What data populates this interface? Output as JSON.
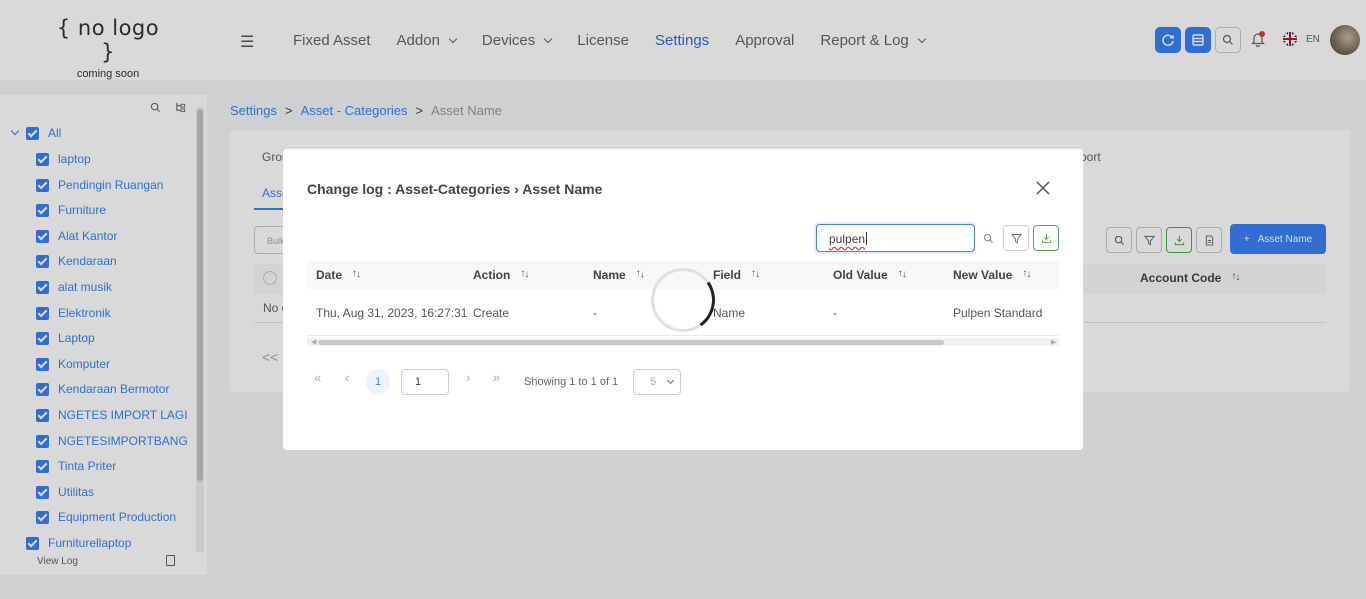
{
  "header": {
    "logo_main": "{ no logo }",
    "logo_sub": "coming soon",
    "nav": [
      {
        "label": "Fixed Asset"
      },
      {
        "label": "Addon"
      },
      {
        "label": "Devices"
      },
      {
        "label": "License"
      },
      {
        "label": "Settings"
      },
      {
        "label": "Approval"
      },
      {
        "label": "Report & Log"
      }
    ],
    "lang": "EN"
  },
  "sidebar": {
    "tree": [
      {
        "label": "All"
      },
      {
        "label": "laptop"
      },
      {
        "label": "Pendingin Ruangan"
      },
      {
        "label": "Furniture"
      },
      {
        "label": "Alat Kantor"
      },
      {
        "label": "Kendaraan"
      },
      {
        "label": "alat musik"
      },
      {
        "label": "Elektronik"
      },
      {
        "label": "Laptop"
      },
      {
        "label": "Komputer"
      },
      {
        "label": "Kendaraan Bermotor"
      },
      {
        "label": "NGETES IMPORT LAGI"
      },
      {
        "label": "NGETESIMPORTBANG"
      },
      {
        "label": "Tinta Priter"
      },
      {
        "label": "Utilitas"
      },
      {
        "label": "Equipment Production"
      },
      {
        "label": "Furniturellaptop"
      }
    ],
    "view_log": "View Log"
  },
  "breadcrumb": {
    "item1": "Settings",
    "item2": "Asset - Categories",
    "current": "Asset Name",
    "sep": ">"
  },
  "background": {
    "tab_left": "Grou",
    "tab_right": "port",
    "tab_active": "Asse",
    "bulk_placeholder": "Bulk",
    "add_button": "Asset Name",
    "account_code_header": "Account Code",
    "no_data": "No d",
    "pager_first": "<<"
  },
  "modal": {
    "title": "Change log : Asset-Categories › Asset Name",
    "search_value": "pulpen",
    "columns": [
      "Date",
      "Action",
      "Name",
      "Field",
      "Old Value",
      "New Value"
    ],
    "rows": [
      {
        "date": "Thu, Aug 31, 2023, 16:27:31",
        "action": "Create",
        "name": "-",
        "field": "Name",
        "old_value": "-",
        "new_value": "Pulpen Standard"
      }
    ],
    "pagination": {
      "current_page": "1",
      "page_input": "1",
      "showing": "Showing 1 to 1 of 1",
      "page_size": "5"
    }
  }
}
